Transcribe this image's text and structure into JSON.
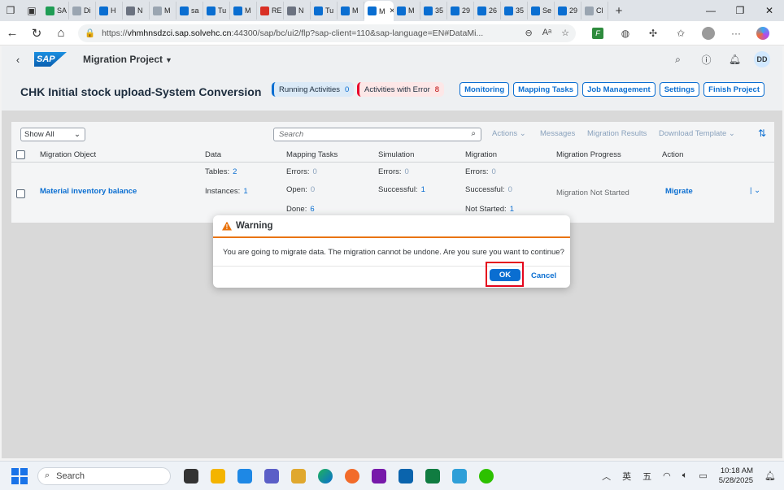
{
  "browser": {
    "tabs": [
      {
        "label": "SA",
        "color": "#1f9d55"
      },
      {
        "label": "Di",
        "color": "#9aa5b1"
      },
      {
        "label": "H",
        "color": "#0a6ed1"
      },
      {
        "label": "N",
        "color": "#6b7280"
      },
      {
        "label": "M",
        "color": "#9aa5b1"
      },
      {
        "label": "sa",
        "color": "#0a6ed1"
      },
      {
        "label": "Tu",
        "color": "#0a6ed1"
      },
      {
        "label": "M",
        "color": "#0a6ed1"
      },
      {
        "label": "RE",
        "color": "#d93025"
      },
      {
        "label": "N",
        "color": "#6b7280"
      },
      {
        "label": "Tu",
        "color": "#0a6ed1"
      },
      {
        "label": "M",
        "color": "#0a6ed1"
      },
      {
        "label": "M",
        "color": "#0a6ed1"
      },
      {
        "label": "M",
        "color": "#0a6ed1"
      },
      {
        "label": "35",
        "color": "#0a6ed1"
      },
      {
        "label": "29",
        "color": "#0a6ed1"
      },
      {
        "label": "26",
        "color": "#0a6ed1"
      },
      {
        "label": "35",
        "color": "#0a6ed1"
      },
      {
        "label": "Se",
        "color": "#0a6ed1"
      },
      {
        "label": "29",
        "color": "#0a6ed1"
      },
      {
        "label": "Cl",
        "color": "#9aa5b1"
      }
    ],
    "url": {
      "prefix": "https://",
      "host": "vhmhnsdzci.sap.solvehc.cn",
      "rest": ":44300/sap/bc/ui2/flp?sap-client=110&sap-language=EN#DataMi..."
    }
  },
  "shell": {
    "app_title": "Migration Project",
    "user_initials": "DD"
  },
  "header": {
    "project_title": "CHK Initial stock upload-System Conversion",
    "running_label": "Running Activities",
    "running_count": "0",
    "error_label": "Activities with Error",
    "error_count": "8",
    "buttons": [
      "Monitoring",
      "Mapping Tasks",
      "Job Management",
      "Settings",
      "Finish Project"
    ]
  },
  "toolbar": {
    "filter_value": "Show All",
    "search_placeholder": "Search",
    "actions_label": "Actions",
    "messages_label": "Messages",
    "results_label": "Migration Results",
    "template_label": "Download Template"
  },
  "table": {
    "columns": [
      "Migration Object",
      "Data",
      "Mapping Tasks",
      "Simulation",
      "Migration",
      "Migration Progress",
      "Action"
    ],
    "row": {
      "object": "Material inventory balance",
      "tables_label": "Tables:",
      "tables_value": "2",
      "instances_label": "Instances:",
      "instances_value": "1",
      "map_errors_label": "Errors:",
      "map_errors_value": "0",
      "map_open_label": "Open:",
      "map_open_value": "0",
      "map_done_label": "Done:",
      "map_done_value": "6",
      "sim_errors_label": "Errors:",
      "sim_errors_value": "0",
      "sim_success_label": "Successful:",
      "sim_success_value": "1",
      "mig_errors_label": "Errors:",
      "mig_errors_value": "0",
      "mig_success_label": "Successful:",
      "mig_success_value": "0",
      "mig_notstarted_label": "Not Started:",
      "mig_notstarted_value": "1",
      "progress": "Migration Not Started",
      "action": "Migrate"
    }
  },
  "dialog": {
    "title": "Warning",
    "message": "You are going to migrate data. The migration cannot be undone. Are you sure you want to continue?",
    "ok_label": "OK",
    "cancel_label": "Cancel"
  },
  "taskbar": {
    "search_label": "Search",
    "ime_1": "英",
    "ime_2": "五",
    "time": "10:18 AM",
    "date": "5/28/2025"
  },
  "colors": {
    "sap_blue": "#0a6ed1",
    "warning": "#e9730c",
    "error": "#bb0000",
    "highlight": "#e4061d"
  }
}
